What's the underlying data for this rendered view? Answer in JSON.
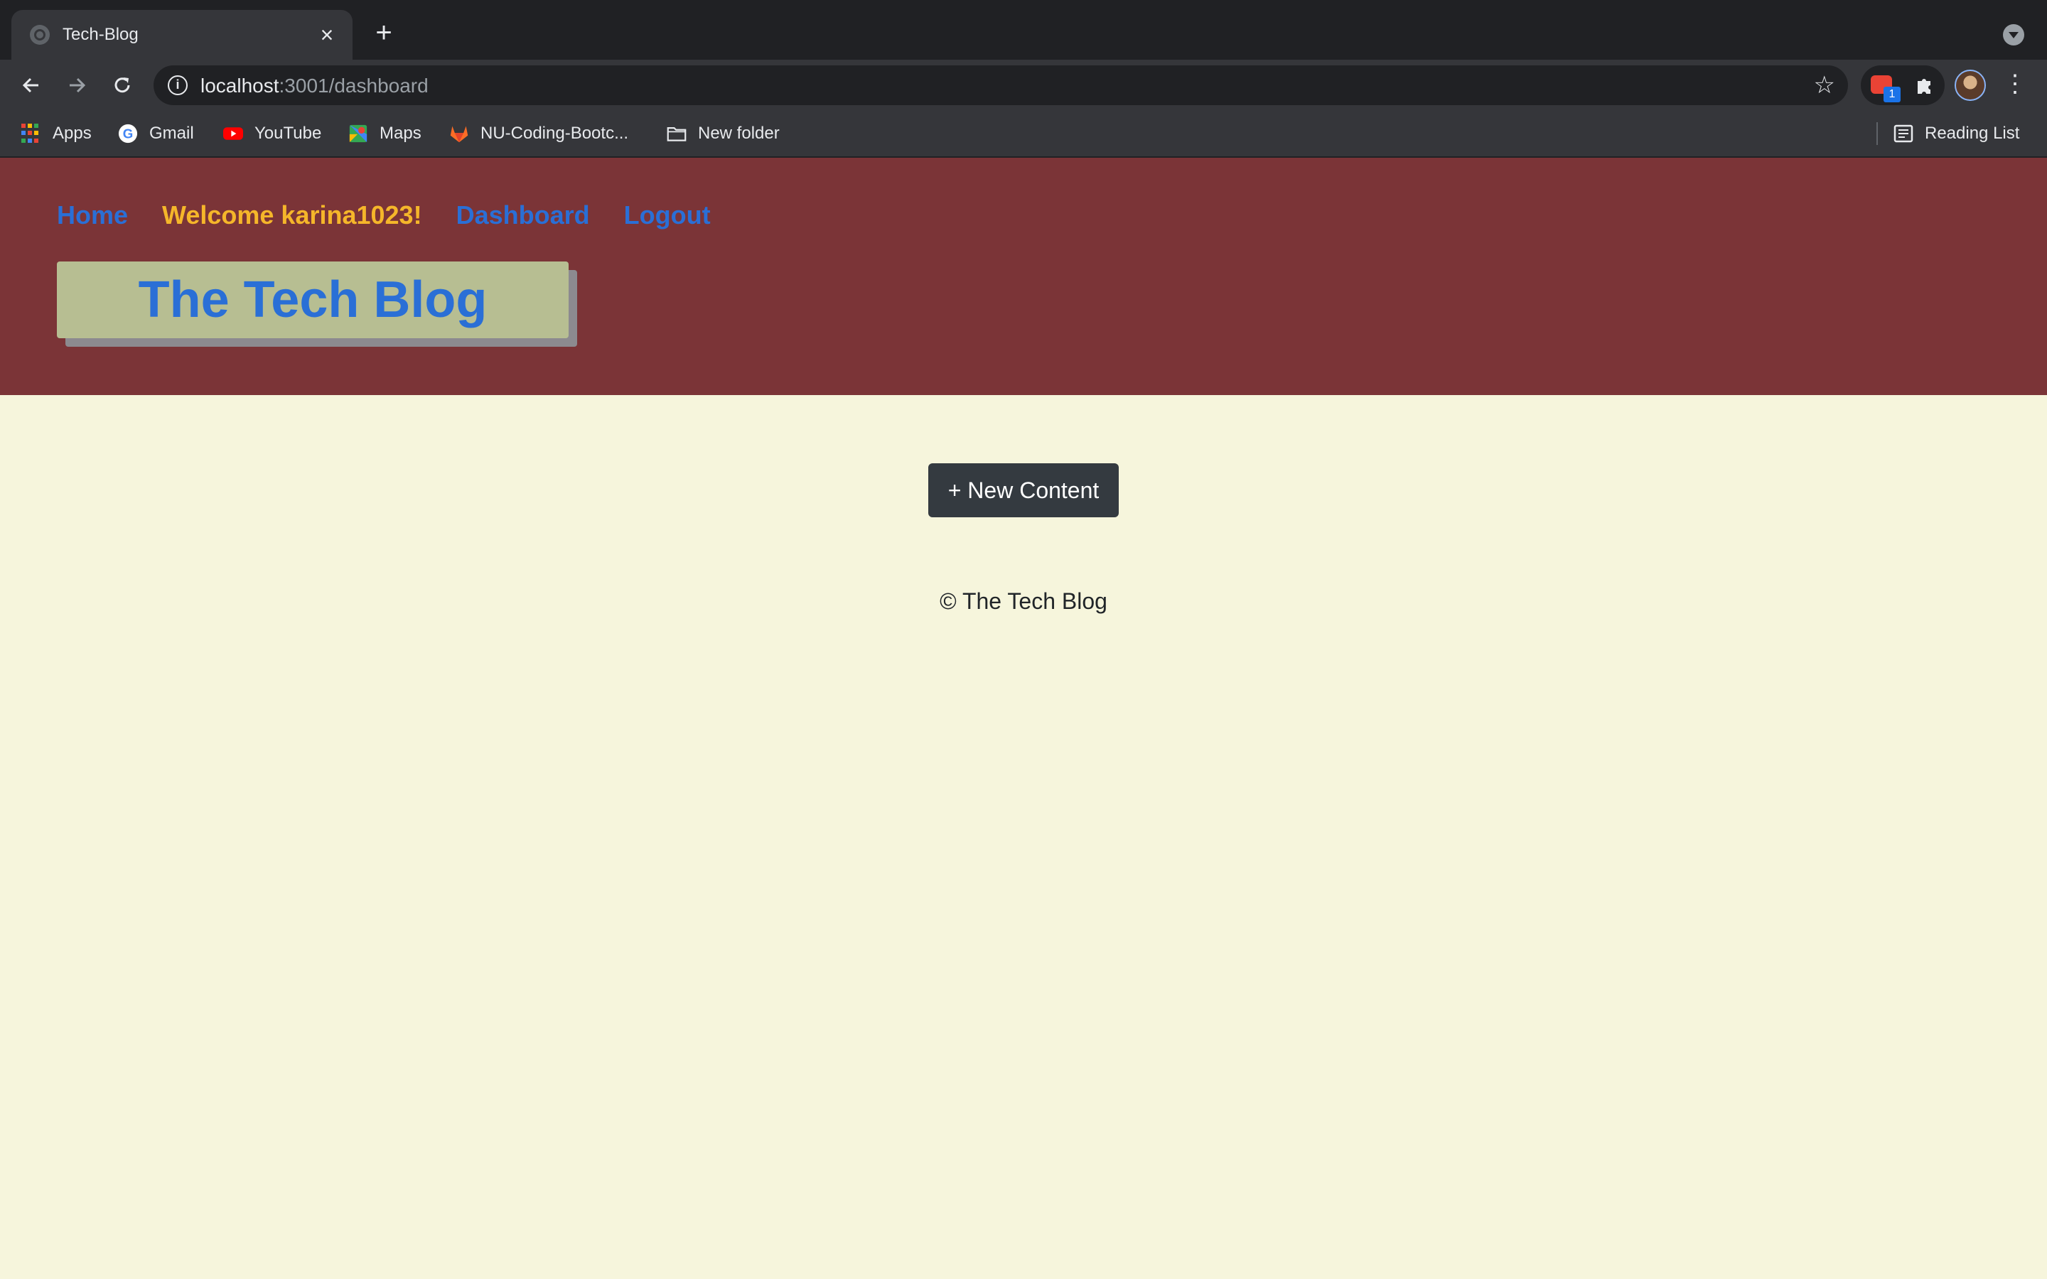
{
  "browser": {
    "tab": {
      "title": "Tech-Blog"
    },
    "address": {
      "host": "localhost",
      "path": ":3001/dashboard"
    },
    "extension_badge": "1",
    "bookmarks": [
      {
        "label": "Apps",
        "icon": "apps-grid-icon"
      },
      {
        "label": "Gmail",
        "icon": "google-icon"
      },
      {
        "label": "YouTube",
        "icon": "youtube-icon"
      },
      {
        "label": "Maps",
        "icon": "maps-icon"
      },
      {
        "label": "NU-Coding-Bootc...",
        "icon": "gitlab-icon"
      },
      {
        "label": "New folder",
        "icon": "folder-icon"
      }
    ],
    "reading_list": "Reading List"
  },
  "site": {
    "nav": {
      "home": "Home",
      "welcome": "Welcome karina1023!",
      "dashboard": "Dashboard",
      "logout": "Logout"
    },
    "brand": "The Tech Blog",
    "new_content_button": "+ New Content",
    "footer": "© The Tech Blog"
  },
  "colors": {
    "header_bg": "#7b3437",
    "page_bg": "#f6f5dc",
    "link": "#2a6fd6",
    "welcome": "#f5b62a",
    "brand_bg": "#b7be92",
    "button_bg": "#343a40"
  }
}
